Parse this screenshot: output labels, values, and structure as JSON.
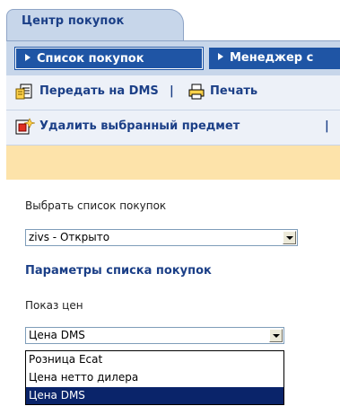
{
  "header": {
    "title": "Центр покупок"
  },
  "tabs": [
    {
      "label": "Список покупок",
      "active": true
    },
    {
      "label": "Менеджер с"
    }
  ],
  "toolbar": {
    "transfer_label": "Передать на DMS",
    "separator": "|",
    "print_label": "Печать",
    "delete_label": "Удалить выбранный предмет"
  },
  "form": {
    "select_list_label": "Выбрать список покупок",
    "select_list_value": "zivs - Открыто",
    "params_title": "Параметры списка покупок",
    "price_label": "Показ цен",
    "price_value": "Цена DMS",
    "price_options": [
      "Розница Ecat",
      "Цена нетто дилера",
      "Цена DMS"
    ],
    "price_selected_index": 2
  },
  "colors": {
    "header_blue": "#1b3f87",
    "tab_bg": "#1f55a5",
    "notice": "#fde3aa",
    "selection": "#0a246a"
  }
}
